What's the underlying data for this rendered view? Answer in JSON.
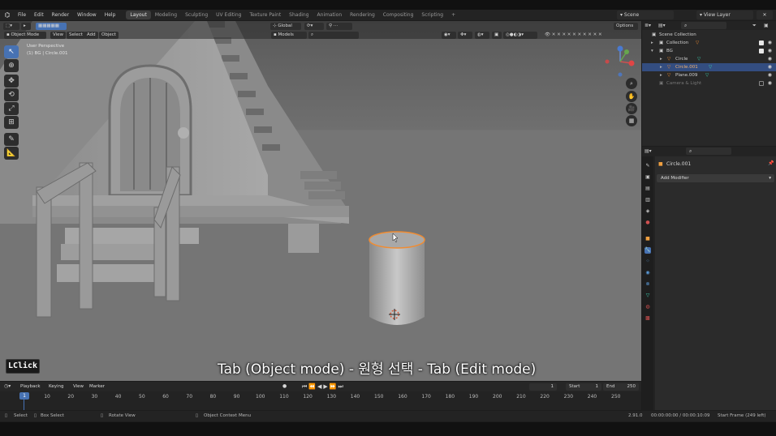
{
  "menu": [
    "File",
    "Edit",
    "Render",
    "Window",
    "Help"
  ],
  "workspaces": [
    {
      "label": "Layout",
      "active": true
    },
    {
      "label": "Modeling",
      "active": false
    },
    {
      "label": "Sculpting",
      "active": false
    },
    {
      "label": "UV Editing",
      "active": false
    },
    {
      "label": "Texture Paint",
      "active": false
    },
    {
      "label": "Shading",
      "active": false
    },
    {
      "label": "Animation",
      "active": false
    },
    {
      "label": "Rendering",
      "active": false
    },
    {
      "label": "Compositing",
      "active": false
    },
    {
      "label": "Scripting",
      "active": false
    }
  ],
  "add_workspace": "+",
  "scene": "Scene",
  "view_layer": "View Layer",
  "viewport": {
    "mode": "Object Mode",
    "menus": [
      "View",
      "Select",
      "Add",
      "Object"
    ],
    "orientation": "Global",
    "options": "Options",
    "models_filter": "Models",
    "perspective_label": "User Perspective",
    "object_label": "(1) BG | Circle.001"
  },
  "subtitle": "Tab (Object mode) - 원형 선택 - Tab (Edit mode)",
  "key_hint": "LClick",
  "outliner": {
    "rows": [
      {
        "label": "Scene Collection",
        "level": 0,
        "selected": false,
        "dim": false
      },
      {
        "label": "Collection",
        "level": 1,
        "selected": false,
        "dim": false
      },
      {
        "label": "BG",
        "level": 1,
        "selected": false,
        "dim": false
      },
      {
        "label": "Circle",
        "level": 2,
        "selected": false,
        "dim": false
      },
      {
        "label": "Circle.001",
        "level": 2,
        "selected": true,
        "dim": false
      },
      {
        "label": "Plane.009",
        "level": 2,
        "selected": false,
        "dim": false
      },
      {
        "label": "Camera & Light",
        "level": 1,
        "selected": false,
        "dim": true
      }
    ]
  },
  "properties": {
    "object_name": "Circle.001",
    "add_modifier": "Add Modifier"
  },
  "timeline": {
    "menus": [
      "Playback",
      "Keying",
      "View",
      "Marker"
    ],
    "current_frame": "1",
    "start_label": "Start",
    "start": "1",
    "end_label": "End",
    "end": "250",
    "ticks": [
      "10",
      "20",
      "30",
      "40",
      "50",
      "60",
      "70",
      "80",
      "90",
      "100",
      "110",
      "120",
      "130",
      "140",
      "150",
      "160",
      "170",
      "180",
      "190",
      "200",
      "210",
      "220",
      "230",
      "240",
      "250"
    ],
    "playhead": "1"
  },
  "status": {
    "select": "Select",
    "box_select": "Box Select",
    "rotate_view": "Rotate View",
    "context_menu": "Object Context Menu",
    "version": "2.91.0",
    "time": "00:00:00:00 / 00:00:10:09",
    "start_frame": "Start Frame (249 left)"
  },
  "colors": {
    "accent": "#4772b3",
    "selection_outline": "#f08c32",
    "outliner_selected": "#334d80"
  }
}
